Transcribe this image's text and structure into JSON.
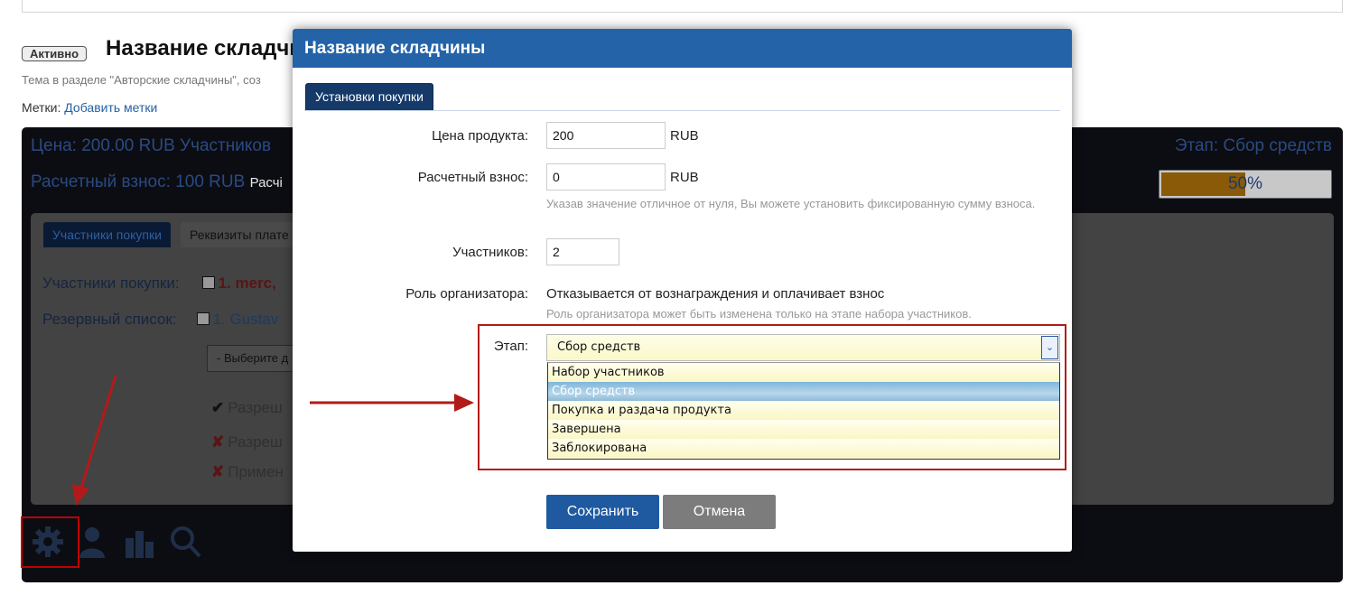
{
  "background": {
    "status_badge": "Активно",
    "title": "Название складчи",
    "subtitle": "Тема в разделе \"Авторские складчины\", соз",
    "tags_label": "Метки:",
    "tags_link": "Добавить метки",
    "price_line": "Цена: 200.00 RUB   Участников",
    "fee_line": "Расчетный взнос: 100 RUB",
    "fee_suffix": "Расчі",
    "stage_line": "Этап: Сбор средств",
    "progress_value": 0.5,
    "progress_label": "50%",
    "tabs": [
      "Участники покупки",
      "Реквизиты плате"
    ],
    "participants_label": "Участники покупки:",
    "participant_1": "1. merc,",
    "reserve_label": "Резервный список:",
    "reserve_1": "1. Gustav",
    "select_placeholder": "- Выберите д",
    "permissions": [
      "Разреш",
      "Разреш",
      "Примен"
    ],
    "perm_marks": [
      "✔",
      "✘",
      "✘"
    ],
    "toolbar_icons": [
      "gear-icon",
      "user-icon",
      "coins-icon",
      "search-user-icon"
    ]
  },
  "modal": {
    "title": "Название складчины",
    "tab": "Установки покупки",
    "price_label": "Цена продукта:",
    "price_value": "200",
    "price_unit": "RUB",
    "fee_label": "Расчетный взнос:",
    "fee_value": "0",
    "fee_unit": "RUB",
    "fee_hint": "Указав значение отличное от нуля, Вы можете установить фиксированную сумму взноса.",
    "participants_label": "Участников:",
    "participants_value": "2",
    "role_label": "Роль организатора:",
    "role_value": "Отказывается от вознаграждения и оплачивает взнос",
    "role_hint": "Роль организатора может быть изменена только на этапе набора участников.",
    "stage_label": "Этап:",
    "stage_selected": "Сбор средств",
    "stage_options": [
      "Набор участников",
      "Сбор средств",
      "Покупка и раздача продукта",
      "Завершена",
      "Заблокирована"
    ],
    "save_label": "Сохранить",
    "cancel_label": "Отмена"
  },
  "colors": {
    "header_blue": "#2463a8",
    "annotation_red": "#b21a1a",
    "save_blue": "#1f5aa0",
    "cancel_gray": "#7c7c7c"
  }
}
